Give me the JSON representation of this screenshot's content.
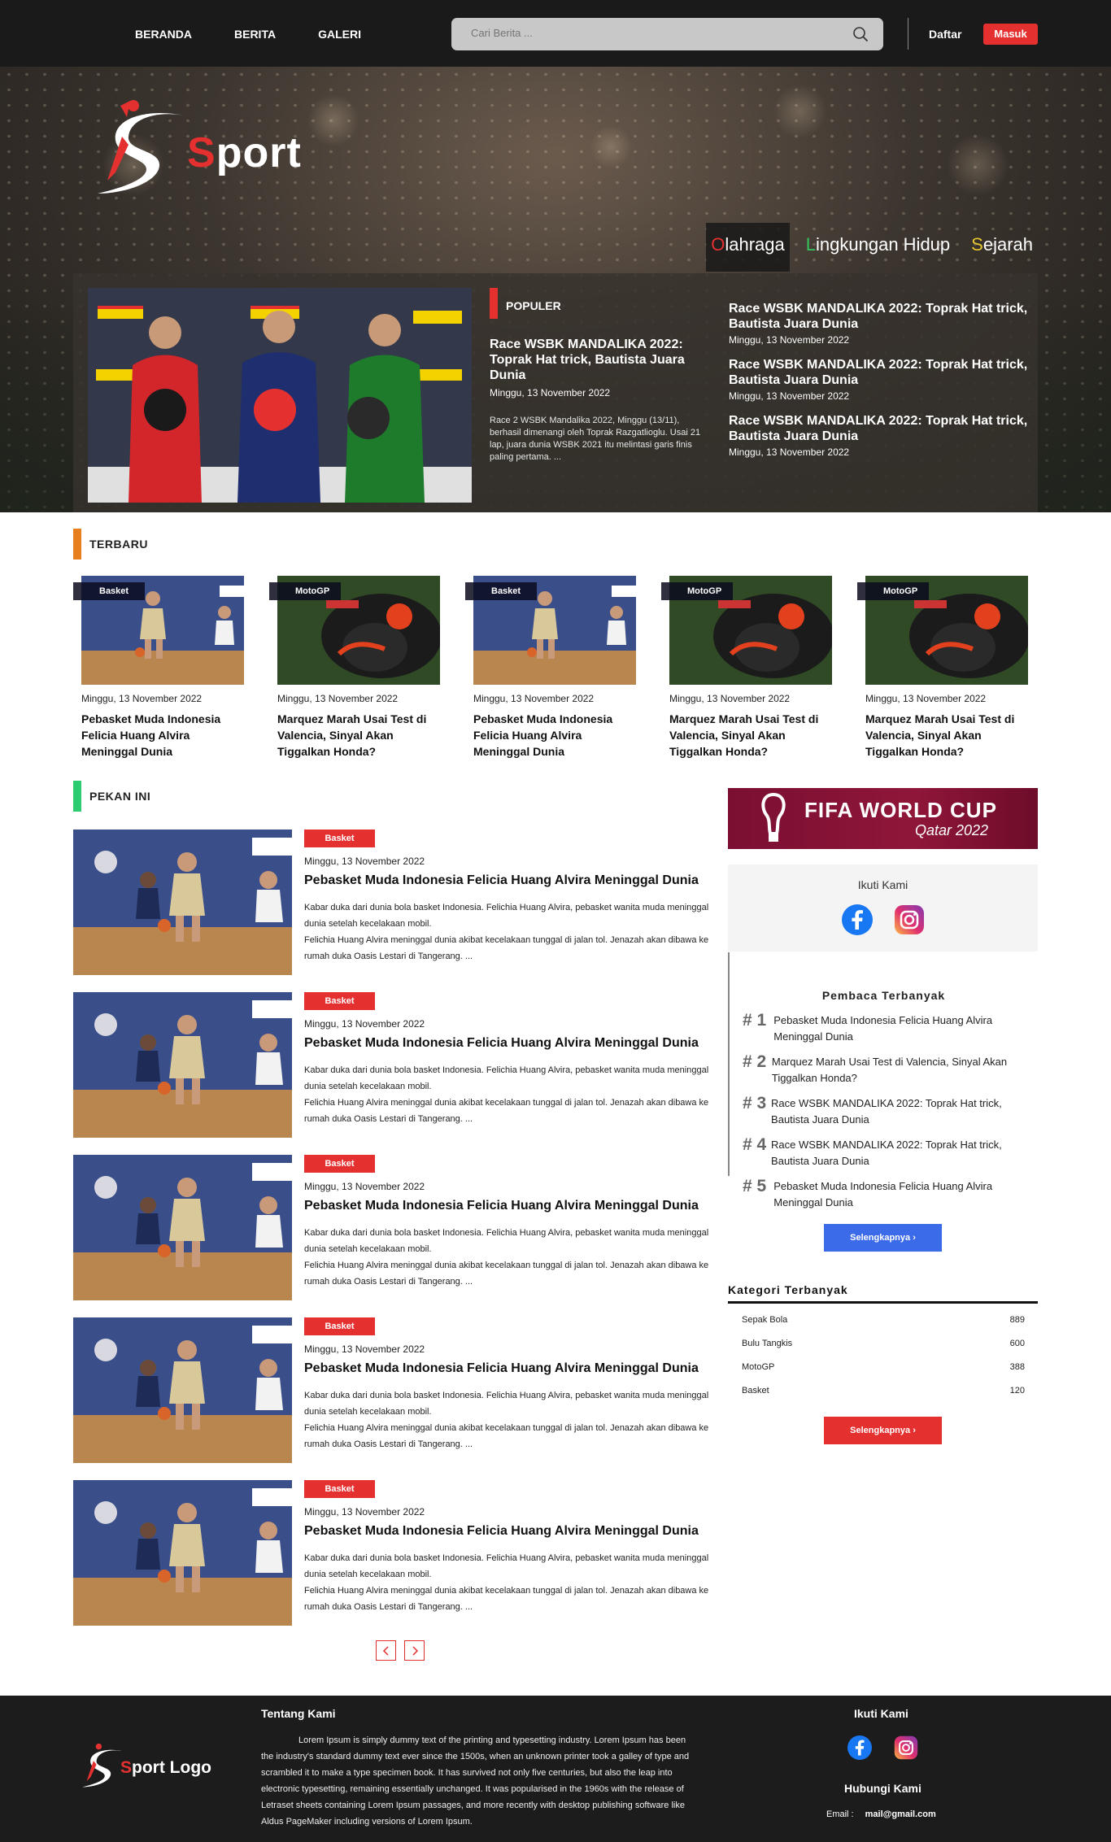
{
  "nav": [
    "BERANDA",
    "BERITA",
    "GALERI"
  ],
  "search": {
    "placeholder": "Cari Berita ..."
  },
  "auth": {
    "register": "Daftar",
    "login": "Masuk"
  },
  "brand": {
    "first": "S",
    "rest": "port"
  },
  "hero_categories": [
    {
      "first": "O",
      "rest": "lahraga",
      "accent": "#e53030"
    },
    {
      "first": "L",
      "rest": "ingkungan Hidup",
      "accent": "#38c25b"
    },
    {
      "first": "S",
      "rest": "ejarah",
      "accent": "#e5c530"
    }
  ],
  "popular": {
    "label": "POPULER",
    "main": {
      "title": "Race WSBK MANDALIKA 2022: Toprak Hat trick, Bautista Juara Dunia",
      "date": "Minggu, 13 November 2022",
      "excerpt": "Race 2 WSBK Mandalika 2022, Minggu (13/11), berhasil dimenangi oleh Toprak Razgatlioglu. Usai 21 lap, juara dunia WSBK 2021 itu melintasi garis finis paling pertama. ..."
    },
    "list": [
      {
        "title": "Race WSBK MANDALIKA 2022: Toprak Hat trick, Bautista Juara Dunia",
        "date": "Minggu, 13 November 2022"
      },
      {
        "title": "Race WSBK MANDALIKA 2022: Toprak Hat trick, Bautista Juara Dunia",
        "date": "Minggu, 13 November 2022"
      },
      {
        "title": "Race WSBK MANDALIKA 2022: Toprak Hat trick, Bautista Juara Dunia",
        "date": "Minggu, 13 November 2022"
      }
    ]
  },
  "latest": {
    "heading": "TERBARU",
    "accent": "#e87f1e",
    "items": [
      {
        "tag": "Basket",
        "date": "Minggu, 13 November 2022",
        "title": "Pebasket Muda Indonesia Felicia Huang Alvira Meninggal Dunia",
        "image": "basketball"
      },
      {
        "tag": "MotoGP",
        "date": "Minggu, 13 November 2022",
        "title": "Marquez Marah Usai Test di Valencia, Sinyal Akan Tiggalkan Honda?",
        "image": "motogp"
      },
      {
        "tag": "Basket",
        "date": "Minggu, 13 November 2022",
        "title": "Pebasket Muda Indonesia Felicia Huang Alvira Meninggal Dunia",
        "image": "basketball"
      },
      {
        "tag": "MotoGP",
        "date": "Minggu, 13 November 2022",
        "title": "Marquez Marah Usai Test di Valencia, Sinyal Akan Tiggalkan Honda?",
        "image": "motogp"
      },
      {
        "tag": "MotoGP",
        "date": "Minggu, 13 November 2022",
        "title": "Marquez Marah Usai Test di Valencia, Sinyal Akan Tiggalkan Honda?",
        "image": "motogp"
      }
    ]
  },
  "week": {
    "heading": "PEKAN INI",
    "accent": "#2ecc71",
    "items": [
      {
        "badge": "Basket",
        "date": "Minggu, 13 November 2022",
        "title": "Pebasket Muda Indonesia Felicia Huang Alvira Meninggal Dunia",
        "excerpt1": "Kabar duka dari dunia bola basket Indonesia. Felichia Huang Alvira, pebasket wanita muda meninggal dunia setelah kecelakaan mobil.",
        "excerpt2": "Felichia Huang Alvira meninggal dunia akibat kecelakaan tunggal di jalan tol. Jenazah akan dibawa ke rumah duka Oasis Lestari di Tangerang. ..."
      },
      {
        "badge": "Basket",
        "date": "Minggu, 13 November 2022",
        "title": "Pebasket Muda Indonesia Felicia Huang Alvira Meninggal Dunia",
        "excerpt1": "Kabar duka dari dunia bola basket Indonesia. Felichia Huang Alvira, pebasket wanita muda meninggal dunia setelah kecelakaan mobil.",
        "excerpt2": "Felichia Huang Alvira meninggal dunia akibat kecelakaan tunggal di jalan tol. Jenazah akan dibawa ke rumah duka Oasis Lestari di Tangerang. ..."
      },
      {
        "badge": "Basket",
        "date": "Minggu, 13 November 2022",
        "title": "Pebasket Muda Indonesia Felicia Huang Alvira Meninggal Dunia",
        "excerpt1": "Kabar duka dari dunia bola basket Indonesia. Felichia Huang Alvira, pebasket wanita muda meninggal dunia setelah kecelakaan mobil.",
        "excerpt2": "Felichia Huang Alvira meninggal dunia akibat kecelakaan tunggal di jalan tol. Jenazah akan dibawa ke rumah duka Oasis Lestari di Tangerang. ..."
      },
      {
        "badge": "Basket",
        "date": "Minggu, 13 November 2022",
        "title": "Pebasket Muda Indonesia Felicia Huang Alvira Meninggal Dunia",
        "excerpt1": "Kabar duka dari dunia bola basket Indonesia. Felichia Huang Alvira, pebasket wanita muda meninggal dunia setelah kecelakaan mobil.",
        "excerpt2": "Felichia Huang Alvira meninggal dunia akibat kecelakaan tunggal di jalan tol. Jenazah akan dibawa ke rumah duka Oasis Lestari di Tangerang. ..."
      },
      {
        "badge": "Basket",
        "date": "Minggu, 13 November 2022",
        "title": "Pebasket Muda Indonesia Felicia Huang Alvira Meninggal Dunia",
        "excerpt1": "Kabar duka dari dunia bola basket Indonesia. Felichia Huang Alvira, pebasket wanita muda meninggal dunia setelah kecelakaan mobil.",
        "excerpt2": "Felichia Huang Alvira meninggal dunia akibat kecelakaan tunggal di jalan tol. Jenazah akan dibawa ke rumah duka Oasis Lestari di Tangerang. ..."
      }
    ]
  },
  "sidebar": {
    "fifa": {
      "title": "FIFA WORLD CUP",
      "subtitle": "Qatar 2022"
    },
    "follow_title": "Ikuti Kami",
    "readers_title": "Pembaca Terbanyak",
    "readers": [
      {
        "rank": "# 1",
        "title": "Pebasket Muda Indonesia Felicia Huang Alvira Meninggal Dunia"
      },
      {
        "rank": "# 2",
        "title": "Marquez Marah Usai Test di Valencia, Sinyal Akan Tiggalkan Honda?"
      },
      {
        "rank": "# 3",
        "title": "Race WSBK MANDALIKA 2022: Toprak Hat trick, Bautista Juara Dunia"
      },
      {
        "rank": "# 4",
        "title": "Race WSBK MANDALIKA 2022: Toprak Hat trick, Bautista Juara Dunia"
      },
      {
        "rank": "# 5",
        "title": "Pebasket Muda Indonesia Felicia Huang Alvira Meninggal Dunia"
      }
    ],
    "readers_more": "Selengkapnya",
    "readers_more_color": "#3b6be8",
    "categories_title": "Kategori Terbanyak",
    "categories": [
      {
        "name": "Sepak Bola",
        "count": "889"
      },
      {
        "name": "Bulu Tangkis",
        "count": "600"
      },
      {
        "name": "MotoGP",
        "count": "388"
      },
      {
        "name": "Basket",
        "count": "120"
      }
    ],
    "categories_more": "Selengkapnya",
    "categories_more_color": "#e53030"
  },
  "footer": {
    "logo_first": "S",
    "logo_rest": "port Logo",
    "about_title": "Tentang Kami",
    "about_text": "Lorem Ipsum is simply dummy text of the printing and typesetting industry. Lorem Ipsum has been the industry's standard dummy text ever since the 1500s, when an unknown printer took a galley of type and scrambled it to make a type specimen book. It has survived not only five centuries, but also the leap into electronic typesetting, remaining essentially unchanged. It was popularised in the 1960s with the release of Letraset sheets containing Lorem Ipsum passages, and more recently with desktop publishing software like Aldus PageMaker including versions of Lorem Ipsum.",
    "follow_title": "Ikuti Kami",
    "contact_title": "Hubungi Kami",
    "email_label": "Email :",
    "email_value": "mail@gmail.com"
  }
}
